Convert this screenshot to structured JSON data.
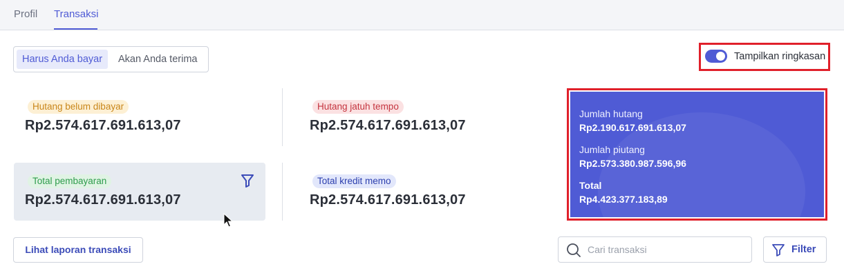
{
  "tabs": [
    {
      "label": "Profil"
    },
    {
      "label": "Transaksi",
      "active": true
    }
  ],
  "segmented": {
    "options": [
      "Harus Anda bayar",
      "Akan Anda terima"
    ],
    "selected": "Harus Anda bayar"
  },
  "summary_toggle": {
    "label": "Tampilkan ringkasan",
    "on": true
  },
  "cards": [
    {
      "badge": "Hutang belum dibayar",
      "amount": "Rp2.574.617.691.613,07"
    },
    {
      "badge": "Hutang jatuh tempo",
      "amount": "Rp2.574.617.691.613,07"
    },
    {
      "badge": "Total pembayaran",
      "amount": "Rp2.574.617.691.613,07"
    },
    {
      "badge": "Total kredit memo",
      "amount": "Rp2.574.617.691.613,07"
    }
  ],
  "summary": {
    "debt_label": "Jumlah hutang",
    "debt_value": "Rp2.190.617.691.613,07",
    "receivable_label": "Jumlah piutang",
    "receivable_value": "Rp2.573.380.987.596,96",
    "total_label": "Total",
    "total_value": "Rp4.423.377.183,89"
  },
  "footer": {
    "report_button": "Lihat laporan transaksi",
    "search_placeholder": "Cari transaksi",
    "filter_button": "Filter"
  },
  "colors": {
    "accent": "#4f5bd5",
    "highlight_border": "#e0202a"
  },
  "icons": [
    "funnel-icon",
    "search-icon",
    "filter-icon",
    "mouse-cursor-icon"
  ]
}
